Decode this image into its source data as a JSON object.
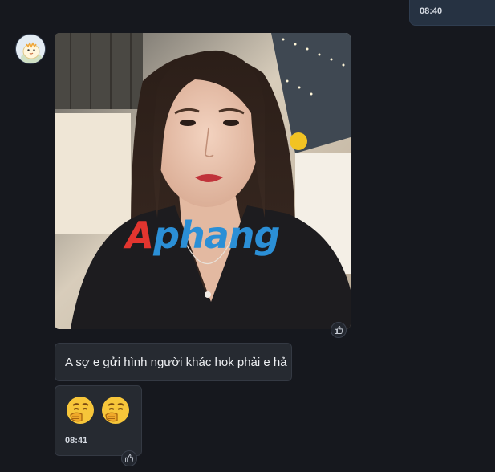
{
  "conversation": {
    "outgoing_last": {
      "time": "08:40"
    },
    "incoming_image": {
      "watermark": {
        "first_letter": "A",
        "rest": "phang"
      },
      "reaction_icon": "thumbs-up-icon"
    },
    "incoming_text": {
      "text": "A sợ e gửi hình người khác hok phải e hả"
    },
    "incoming_emoji": {
      "emojis": [
        "thinking-face-icon",
        "thinking-face-icon"
      ],
      "time": "08:41",
      "reaction_icon": "thumbs-up-icon"
    }
  },
  "colors": {
    "background": "#16181e",
    "bubble_in": "#262a31",
    "bubble_out": "#263242",
    "watermark_red": "#e2352f",
    "watermark_blue": "#2b8fd6"
  }
}
